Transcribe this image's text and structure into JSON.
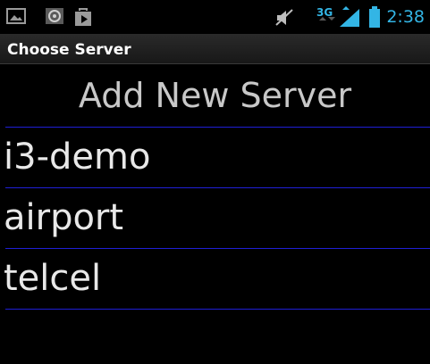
{
  "status_bar": {
    "left_icons": [
      "image-icon",
      "at-sign-icon",
      "play-store-icon"
    ],
    "right_icons": [
      "mute-icon",
      "3g-icon",
      "signal-icon",
      "battery-icon"
    ],
    "network_type": "3G",
    "time": "2:38",
    "accent_color": "#33b5e5"
  },
  "title_bar": {
    "title": "Choose Server"
  },
  "add_server": {
    "label": "Add New Server"
  },
  "servers": [
    {
      "label": "i3-demo"
    },
    {
      "label": "airport"
    },
    {
      "label": "telcel"
    }
  ],
  "colors": {
    "background": "#000000",
    "divider": "#1f1fd6"
  }
}
